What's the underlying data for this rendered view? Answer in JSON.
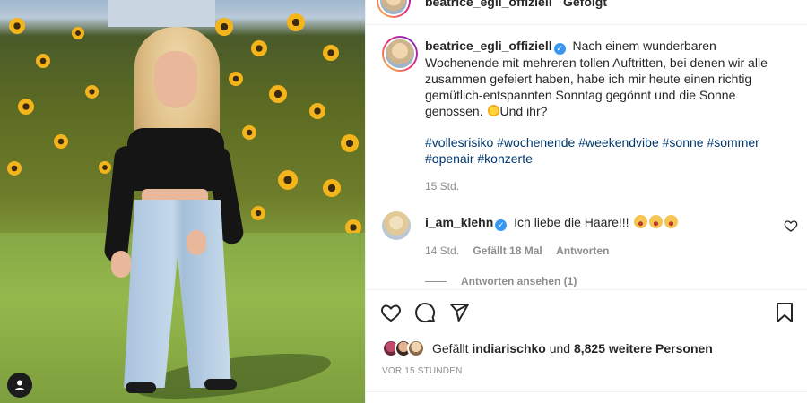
{
  "post": {
    "header_username": "beatrice_egli_offiziell",
    "header_follow": "Gefolgt",
    "caption": {
      "username": "beatrice_egli_offiziell",
      "text": "Nach einem wunderbaren Wochenende mit mehreren tollen Auftritten, bei denen wir alle zusammen gefeiert haben, habe ich mir heute einen richtig gemütlich-entspannten Sonntag gegönnt und die Sonne genossen. ",
      "text_end": "Und ihr?",
      "hashtags": [
        "#vollesrisiko",
        "#wochenende",
        "#weekendvibe",
        "#sonne",
        "#sommer",
        "#openair",
        "#konzerte"
      ],
      "time": "15 Std."
    },
    "comment": {
      "username": "i_am_klehn",
      "text": "Ich liebe die Haare!!!",
      "time": "14 Std.",
      "likes": "Gefällt 18 Mal",
      "reply": "Antworten"
    },
    "view_replies": "Antworten ansehen (1)",
    "likes": {
      "prefix": "Gefällt",
      "user": "indiarischko",
      "middle": "und",
      "others": "8,825 weitere Personen"
    },
    "posted": "VOR 15 STUNDEN"
  },
  "icons": {
    "like": "heart-icon",
    "comment": "comment-icon",
    "share": "share-icon",
    "save": "bookmark-icon",
    "tag": "user-tag-icon"
  },
  "colors": {
    "link": "#00376b",
    "verified": "#3897f0",
    "muted": "#8e8e8e"
  }
}
